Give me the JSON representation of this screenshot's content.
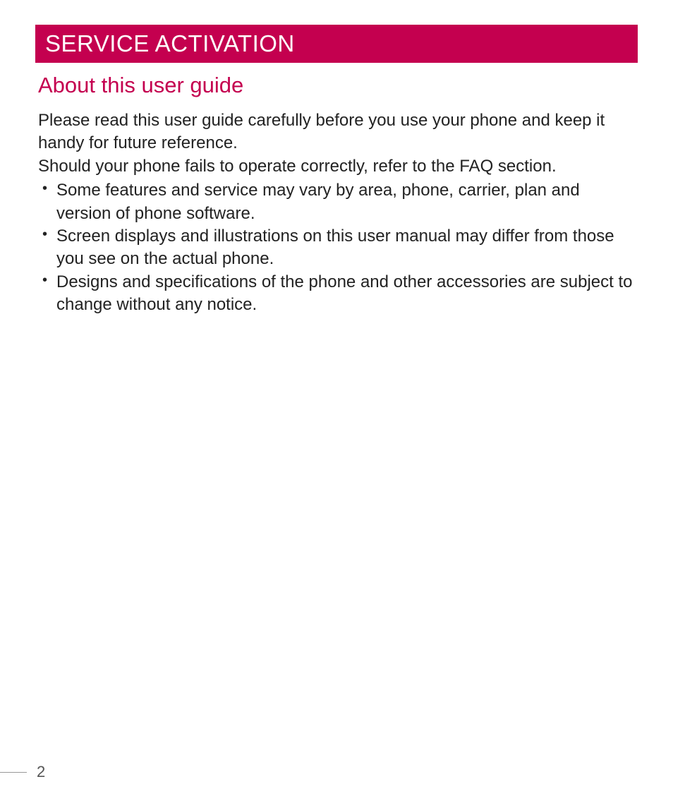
{
  "header": {
    "sectionTitle": "SERVICE ACTIVATION"
  },
  "subsection": {
    "title": "About this user guide"
  },
  "paragraphs": {
    "p1": "Please read this user guide carefully before you use your phone and keep it handy for future reference.",
    "p2": "Should your phone fails to operate correctly, refer to the FAQ section."
  },
  "bullets": {
    "b1": "Some features and service may vary by area, phone, carrier, plan and version of phone software.",
    "b2": "Screen displays and illustrations on this user manual may differ from those you see on the actual phone.",
    "b3": "Designs and specifications of the phone and other accessories are subject to change without any notice."
  },
  "pageNumber": "2"
}
